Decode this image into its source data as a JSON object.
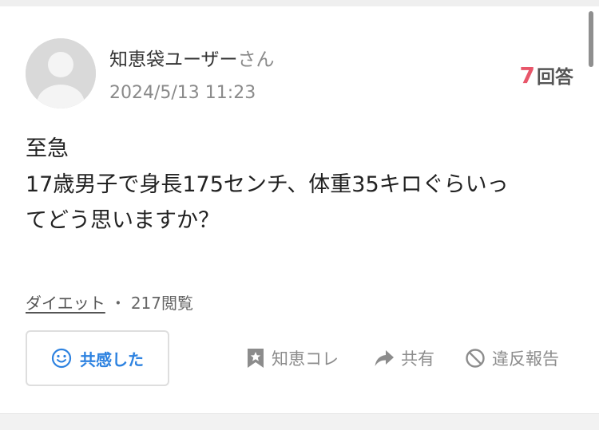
{
  "question_card": {
    "user": {
      "name": "知恵袋ユーザー",
      "suffix": "さん"
    },
    "posted_at": "2024/5/13 11:23",
    "answer_count": "7",
    "answer_label": "回答",
    "question_lines": [
      "至急",
      "17歳男子で身長175センチ、体重35キロぐらいっ",
      "てどう思いますか？"
    ],
    "category": "ダイエット",
    "separator": "・",
    "views": "217閲覧",
    "actions": {
      "empathy_label": "共感した",
      "save_label": "知恵コレ",
      "share_label": "共有",
      "report_label": "違反報告"
    }
  },
  "icons": {
    "avatar": "default-user-avatar",
    "empathy": "smile-icon",
    "save": "bookmark-star-icon",
    "share": "share-arrow-icon",
    "report": "prohibited-icon"
  },
  "colors": {
    "accent_blue": "#2d82e0",
    "answer_count_pink": "#e8566a",
    "muted_gray": "#8a8a8a"
  }
}
